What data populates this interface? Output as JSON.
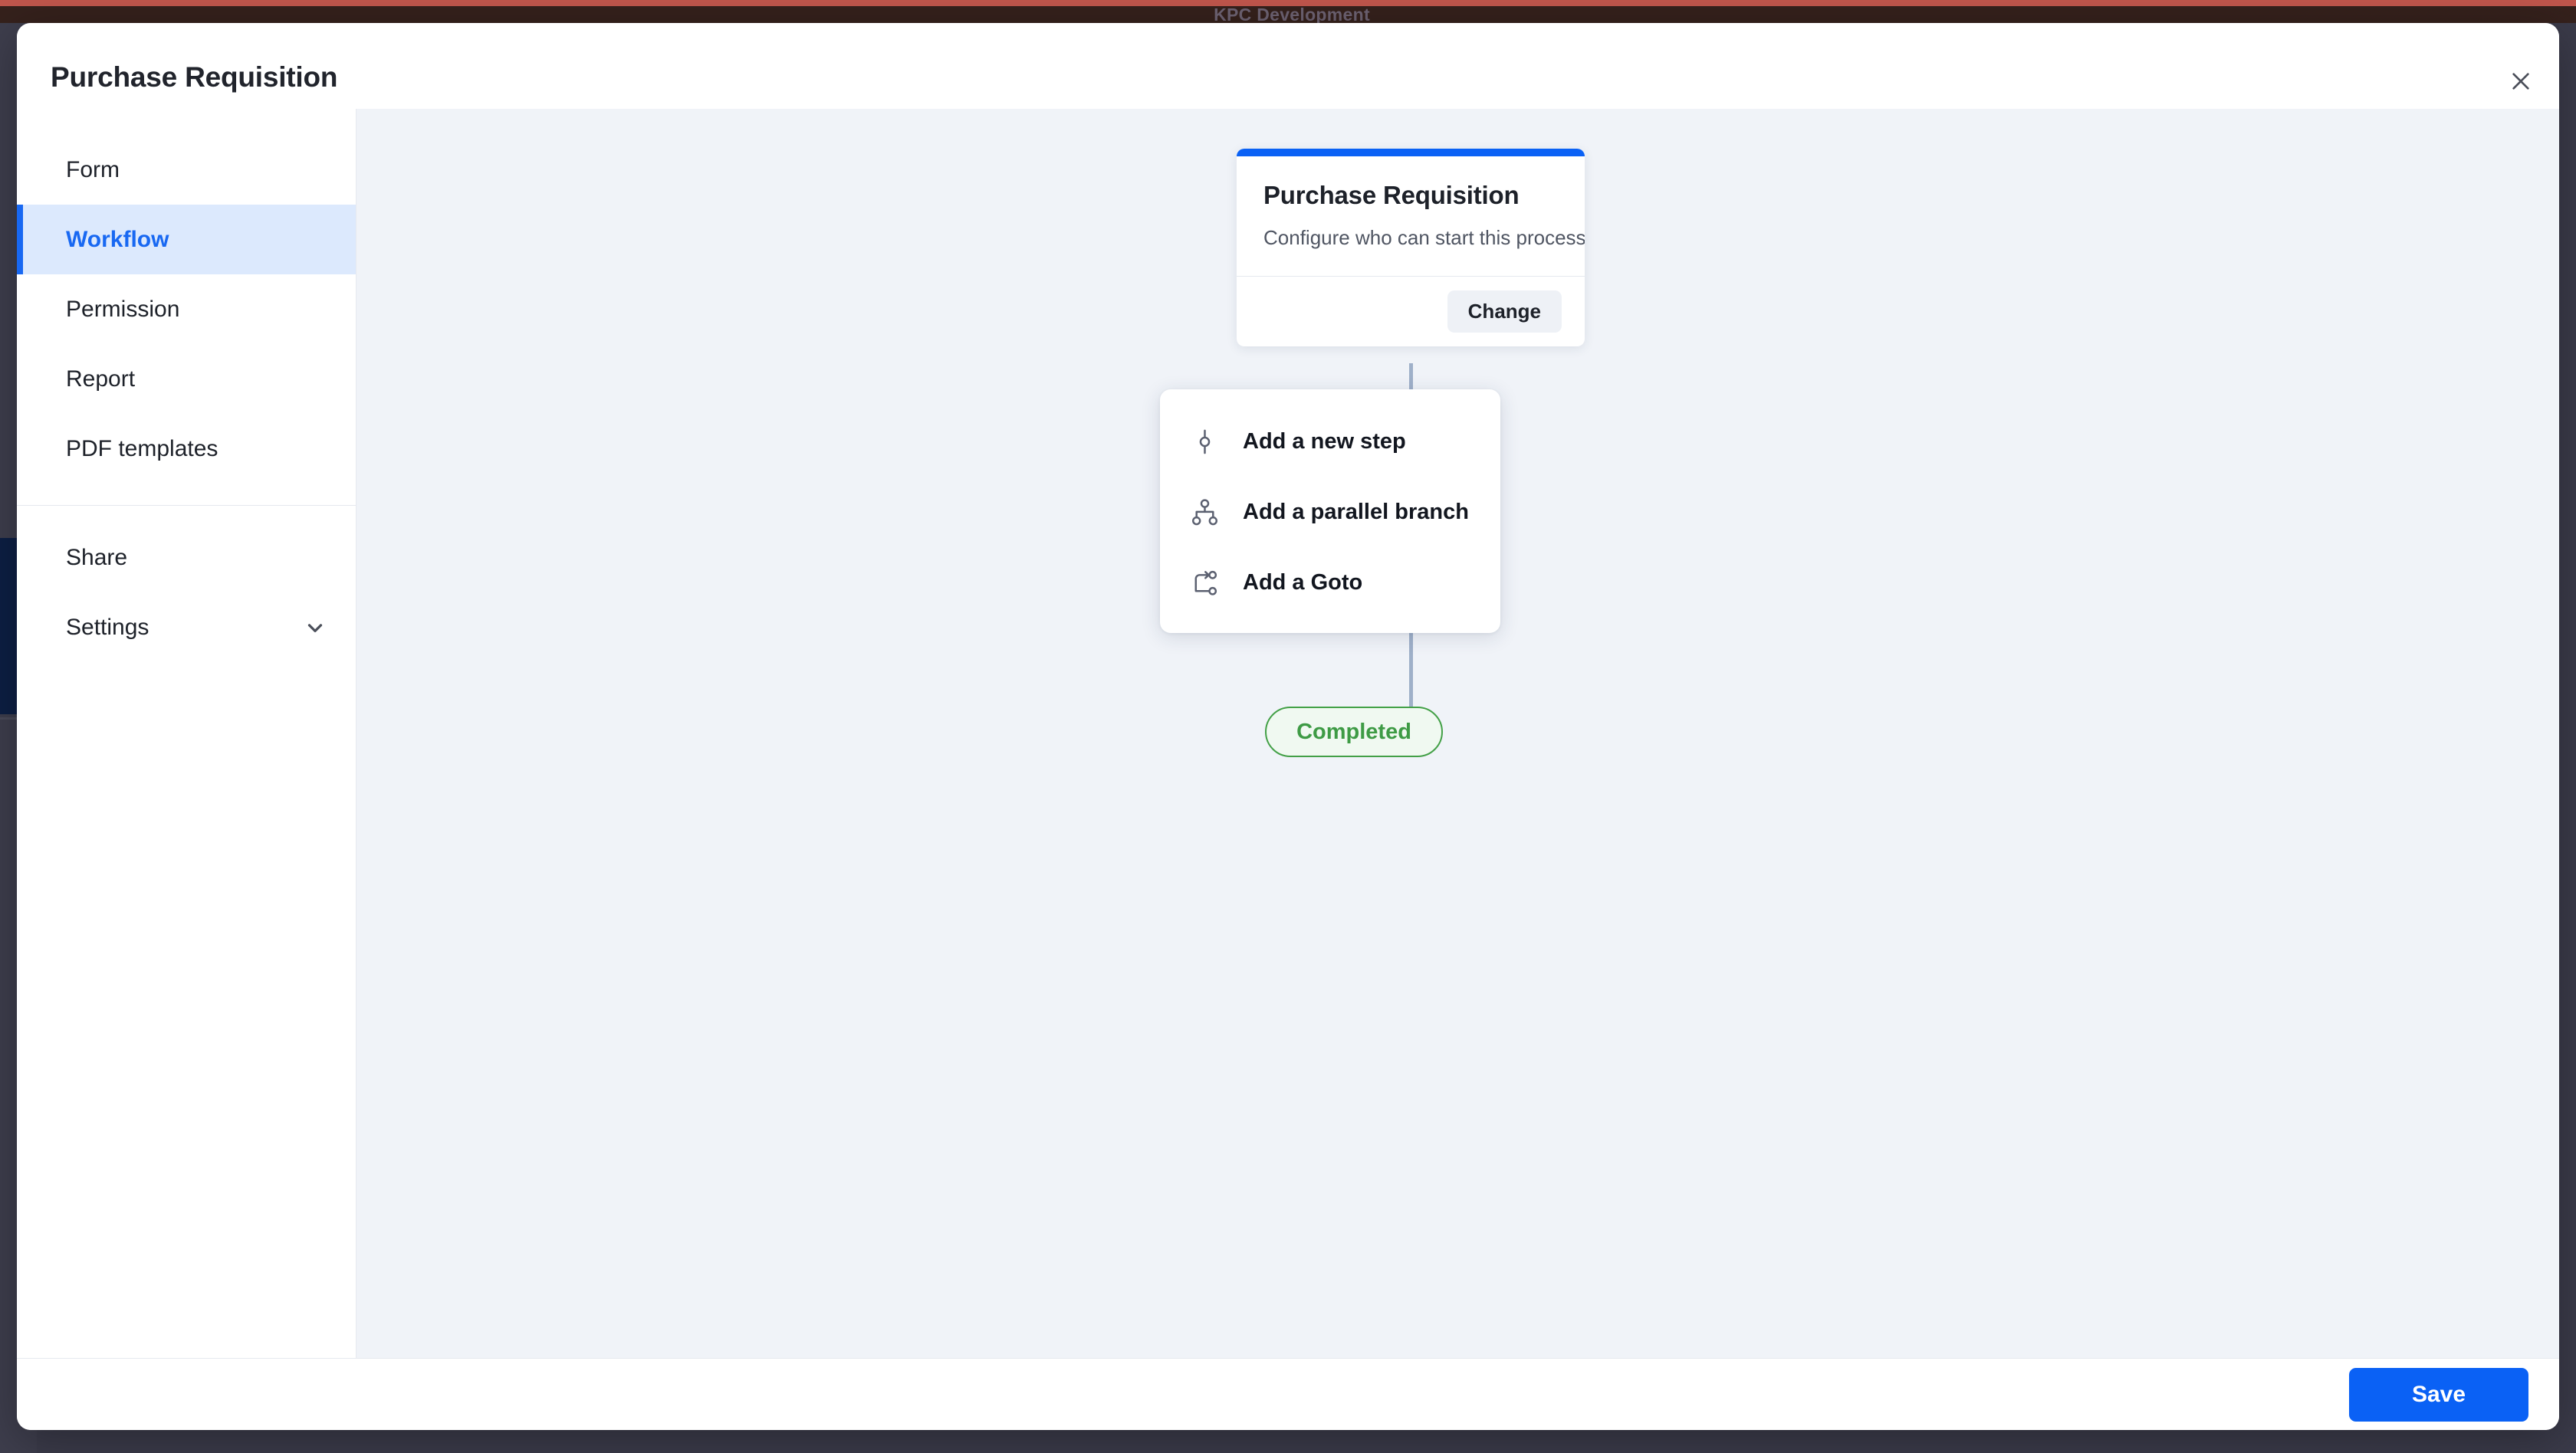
{
  "environment": {
    "banner_label": "KPC Development"
  },
  "modal": {
    "title": "Purchase Requisition",
    "close_icon": "close-icon"
  },
  "sidebar": {
    "items": [
      {
        "label": "Form",
        "active": false
      },
      {
        "label": "Workflow",
        "active": true
      },
      {
        "label": "Permission",
        "active": false
      },
      {
        "label": "Report",
        "active": false
      },
      {
        "label": "PDF templates",
        "active": false
      }
    ],
    "secondary_items": [
      {
        "label": "Share",
        "icon": null
      },
      {
        "label": "Settings",
        "icon": "chevron-down-icon"
      }
    ]
  },
  "canvas": {
    "start_card": {
      "title": "Purchase Requisition",
      "description": "Configure who can start this process",
      "change_label": "Change",
      "accent_color": "#0a61f5"
    },
    "action_menu": {
      "items": [
        {
          "label": "Add a new step",
          "icon": "node-step-icon"
        },
        {
          "label": "Add a parallel branch",
          "icon": "parallel-branch-icon"
        },
        {
          "label": "Add a Goto",
          "icon": "goto-icon"
        }
      ]
    },
    "end_node": {
      "label": "Completed",
      "border_color": "#43a047",
      "text_color": "#3e9b45",
      "background_color": "#f0f9f1"
    },
    "connector_color": "#9fb0c9",
    "background_color": "#f0f3f8"
  },
  "footer": {
    "save_label": "Save",
    "save_color": "#0a61f5"
  }
}
